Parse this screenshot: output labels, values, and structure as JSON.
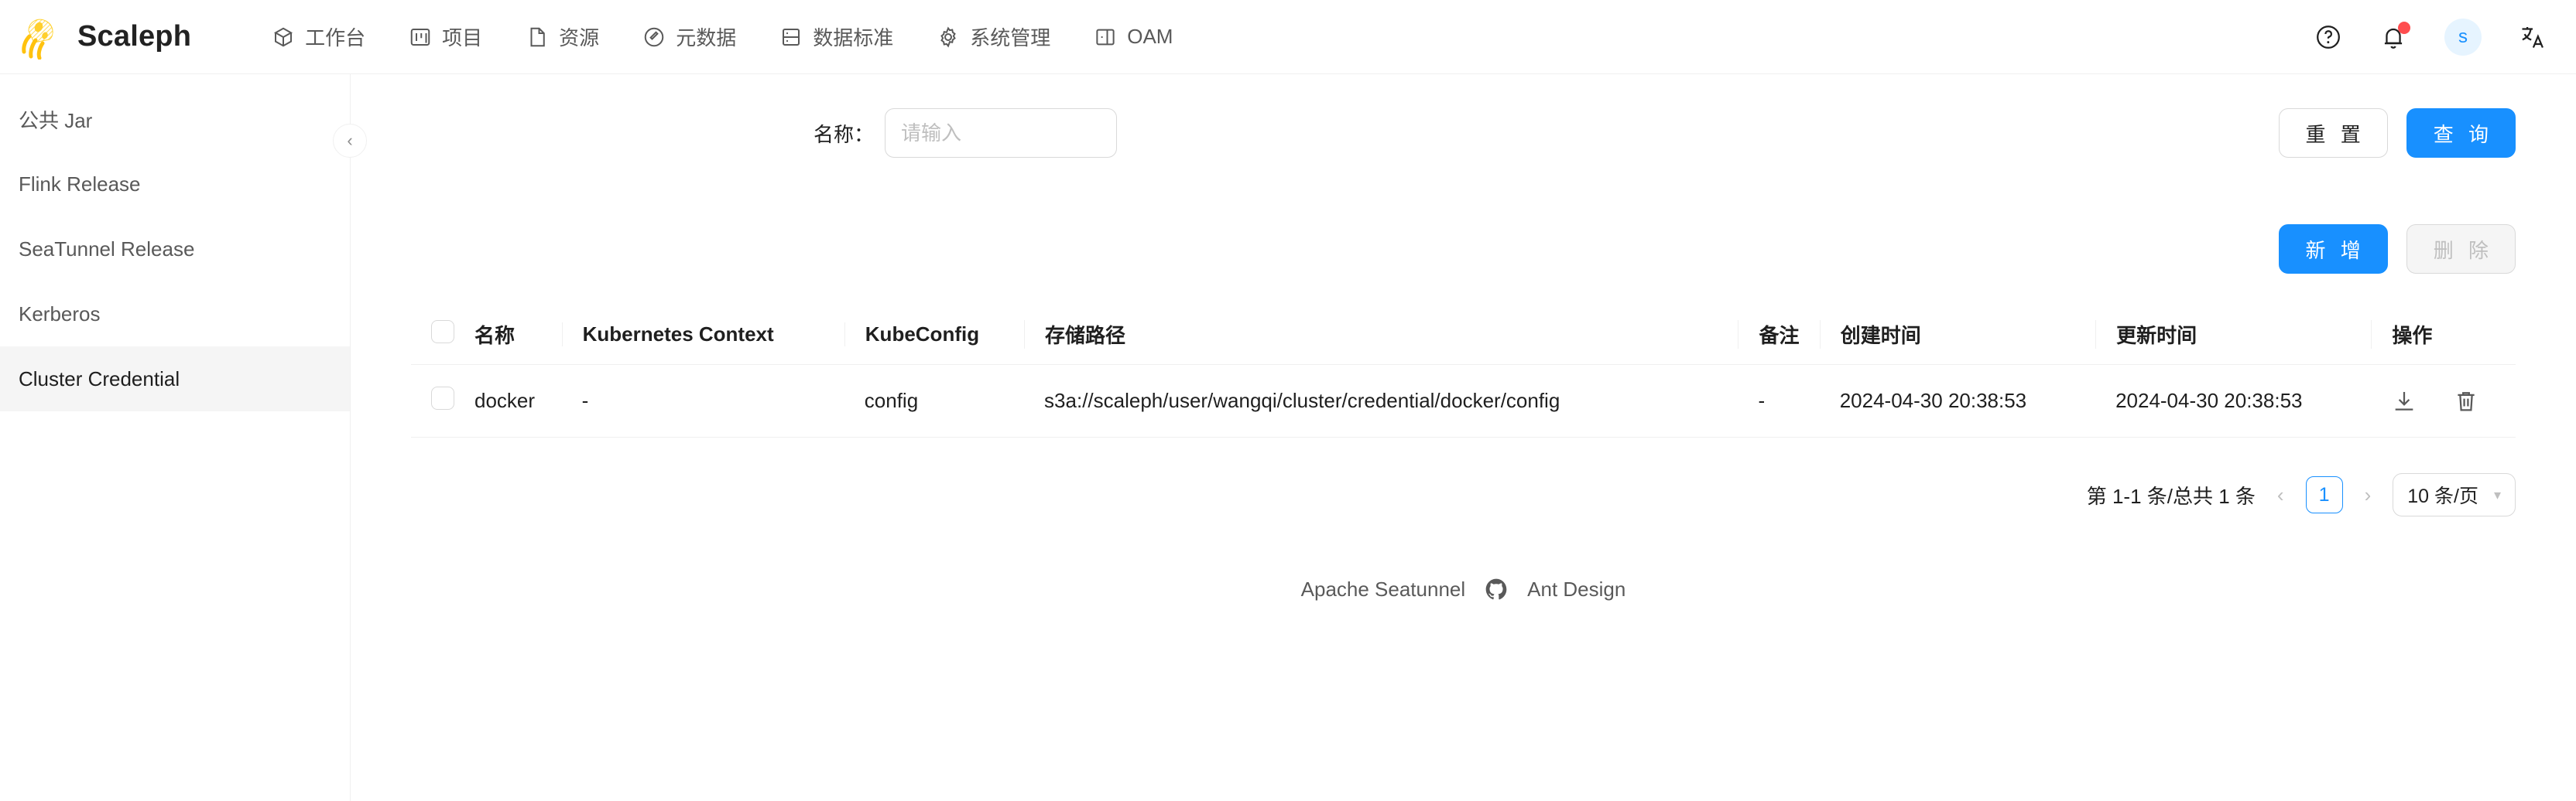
{
  "brand": {
    "name": "Scaleph",
    "logo_icon": "jellyfish-logo",
    "accent": "#1890ff"
  },
  "nav": {
    "items": [
      {
        "label": "工作台",
        "icon": "dashboard-icon"
      },
      {
        "label": "项目",
        "icon": "project-icon"
      },
      {
        "label": "资源",
        "icon": "file-icon"
      },
      {
        "label": "元数据",
        "icon": "compass-icon"
      },
      {
        "label": "数据标准",
        "icon": "database-icon"
      },
      {
        "label": "系统管理",
        "icon": "gear-icon"
      },
      {
        "label": "OAM",
        "icon": "window-icon"
      }
    ]
  },
  "header_right": {
    "help_icon": "question-circle-icon",
    "bell_icon": "bell-icon",
    "avatar_text": "s",
    "locale_icon": "translate-icon",
    "badge_color": "#ff4d4f"
  },
  "sidebar": {
    "collapse_icon": "chevron-left-icon",
    "items": [
      {
        "label": "公共 Jar",
        "active": false
      },
      {
        "label": "Flink Release",
        "active": false
      },
      {
        "label": "SeaTunnel Release",
        "active": false
      },
      {
        "label": "Kerberos",
        "active": false
      },
      {
        "label": "Cluster Credential",
        "active": true
      }
    ]
  },
  "search": {
    "name_label": "名称：",
    "name_value": "",
    "name_placeholder": "请输入",
    "reset_label": "重 置",
    "query_label": "查 询"
  },
  "toolbar": {
    "add_label": "新 增",
    "delete_label": "删 除"
  },
  "table": {
    "columns": [
      "名称",
      "Kubernetes Context",
      "KubeConfig",
      "存储路径",
      "备注",
      "创建时间",
      "更新时间",
      "操作"
    ],
    "rows": [
      {
        "name": "docker",
        "kubernetes_context": "-",
        "kubeconfig": "config",
        "storage_path": "s3a://scaleph/user/wangqi/cluster/credential/docker/config",
        "remark": "-",
        "create_time": "2024-04-30 20:38:53",
        "update_time": "2024-04-30 20:38:53",
        "actions": [
          "download-icon",
          "delete-icon"
        ]
      }
    ]
  },
  "pagination": {
    "summary": "第 1-1 条/总共 1 条",
    "prev_icon": "chevron-left-icon",
    "next_icon": "chevron-right-icon",
    "current_page": "1",
    "page_size_label": "10 条/页"
  },
  "footer": {
    "link1": "Apache Seatunnel",
    "github_icon": "github-icon",
    "link2": "Ant Design"
  }
}
